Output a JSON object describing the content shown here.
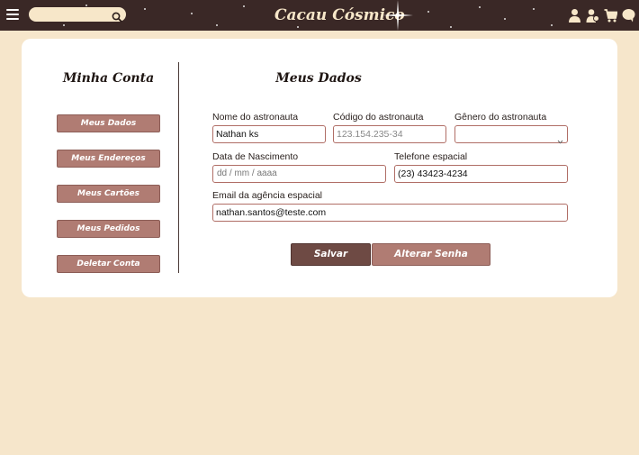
{
  "header": {
    "brand": "Cacau Cósmico",
    "search_placeholder": "",
    "icons": [
      "menu-icon",
      "search-icon",
      "user-icon",
      "account-icon",
      "cart-icon",
      "chat-icon"
    ]
  },
  "sidebar": {
    "title": "Minha Conta",
    "items": [
      {
        "label": "Meus Dados"
      },
      {
        "label": "Meus Endereços"
      },
      {
        "label": "Meus Cartões"
      },
      {
        "label": "Meus Pedidos"
      },
      {
        "label": "Deletar Conta"
      }
    ]
  },
  "form": {
    "title": "Meus Dados",
    "name": {
      "label": "Nome do astronauta",
      "value": "Nathan ks"
    },
    "code": {
      "label": "Código do astronauta",
      "placeholder": "123.154.235-34"
    },
    "gender": {
      "label": "Gênero do astronauta",
      "value": ""
    },
    "birth": {
      "label": "Data de Nascimento",
      "placeholder": "dd / mm / aaaa"
    },
    "phone": {
      "label": "Telefone espacial",
      "value": "(23) 43423-4234"
    },
    "email": {
      "label": "Email da agência espacial",
      "value": "nathan.santos@teste.com"
    },
    "save_label": "Salvar",
    "change_password_label": "Alterar Senha"
  },
  "colors": {
    "header_bg": "#3a2826",
    "page_bg": "#f6e6cb",
    "accent": "#b07c73",
    "accent_dark": "#6e4a44",
    "input_border": "#b06e66"
  }
}
